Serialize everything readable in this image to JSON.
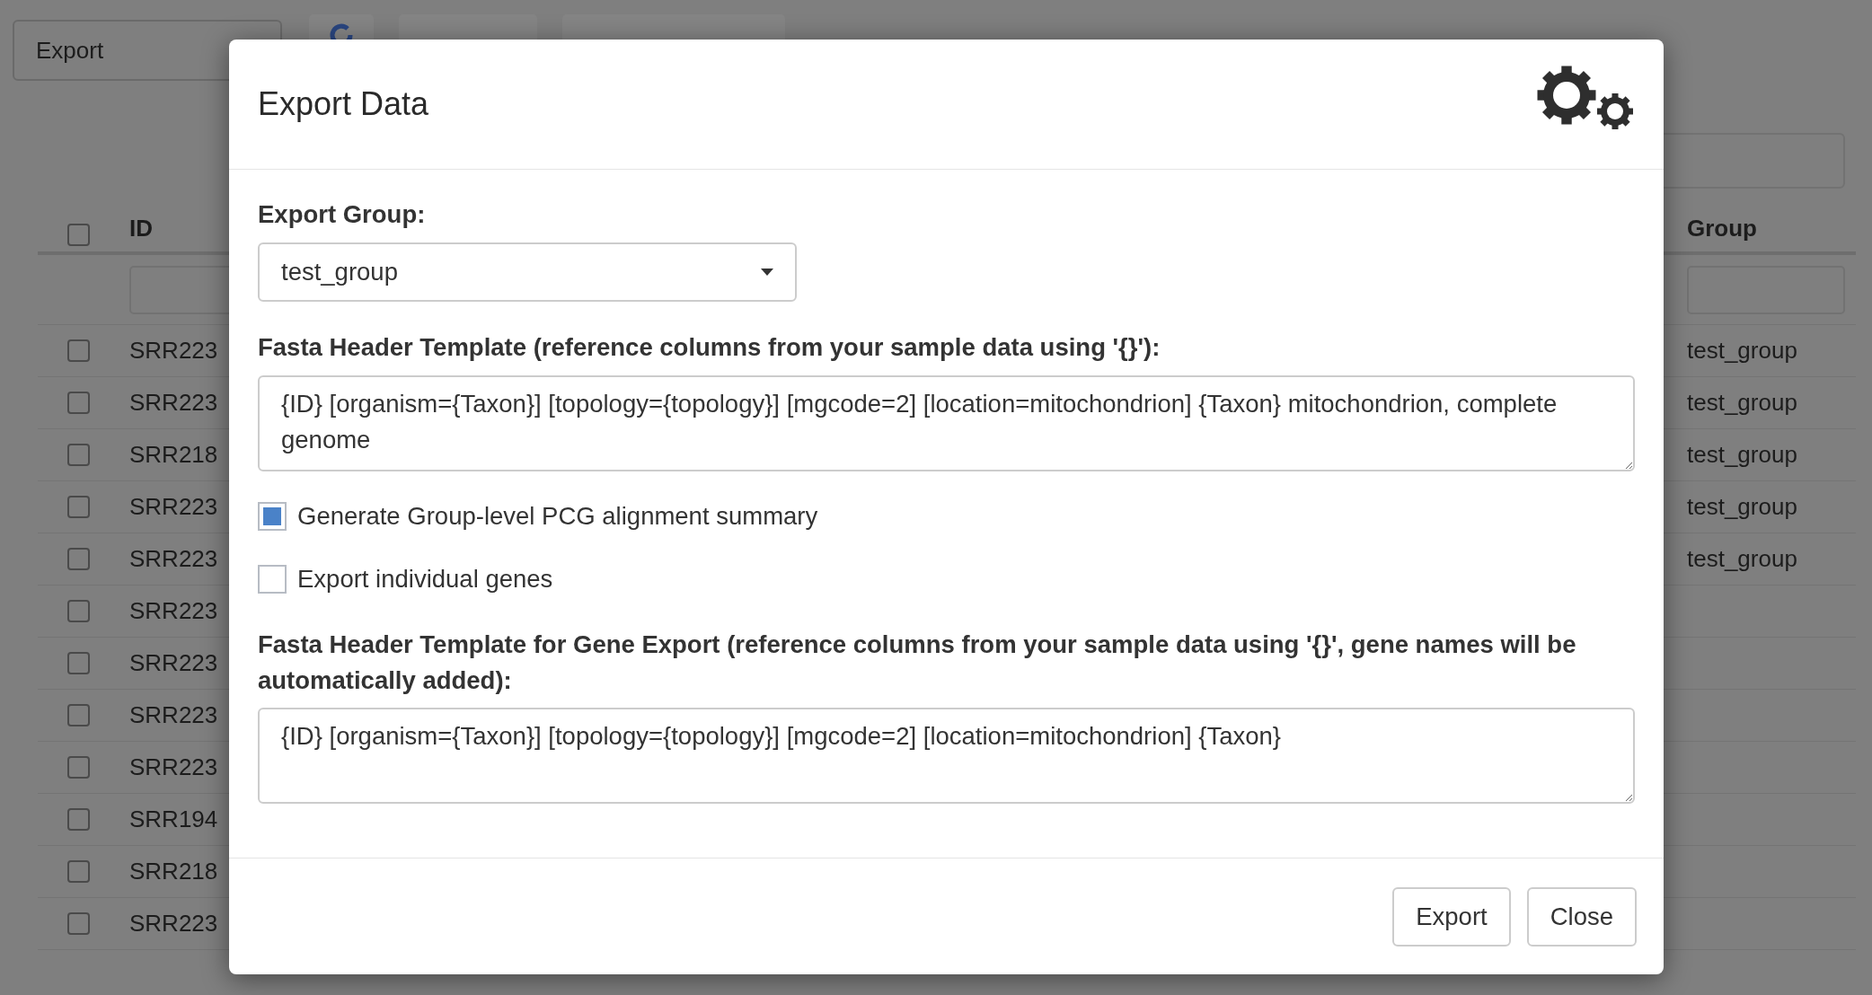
{
  "background": {
    "export_select": {
      "value": "Export"
    },
    "table": {
      "columns": [
        "ID",
        "Group"
      ],
      "select_all": {
        "checked": false
      },
      "rows": [
        {
          "id": "SRR223",
          "group": "test_group",
          "checked": false
        },
        {
          "id": "SRR223",
          "group": "test_group",
          "checked": false
        },
        {
          "id": "SRR218",
          "group": "test_group",
          "checked": false
        },
        {
          "id": "SRR223",
          "group": "test_group",
          "checked": false
        },
        {
          "id": "SRR223",
          "group": "test_group",
          "checked": false
        },
        {
          "id": "SRR223",
          "checked": false
        },
        {
          "id": "SRR223",
          "checked": false
        },
        {
          "id": "SRR223",
          "checked": false
        },
        {
          "id": "SRR223",
          "checked": false
        },
        {
          "id": "SRR194",
          "checked": false
        },
        {
          "id": "SRR218",
          "checked": false
        },
        {
          "id": "SRR223",
          "checked": false
        }
      ]
    }
  },
  "dialog": {
    "title": "Export Data",
    "export_group": {
      "label": "Export Group:",
      "value": "test_group"
    },
    "header_template": {
      "label": "Fasta Header Template (reference columns from your sample data using '{}'):",
      "value": "{ID} [organism={Taxon}] [topology={topology}] [mgcode=2] [location=mitochondrion] {Taxon} mitochondrion, complete genome"
    },
    "options": [
      {
        "label": "Generate Group-level PCG alignment summary",
        "checked": true
      },
      {
        "label": "Export individual genes",
        "checked": false
      }
    ],
    "gene_header_template": {
      "label": "Fasta Header Template for Gene Export (reference columns from your sample data using '{}', gene names will be automatically added):",
      "value": "{ID} [organism={Taxon}] [topology={topology}] [mgcode=2] [location=mitochondrion] {Taxon}"
    },
    "buttons": [
      "Export",
      "Close"
    ]
  }
}
